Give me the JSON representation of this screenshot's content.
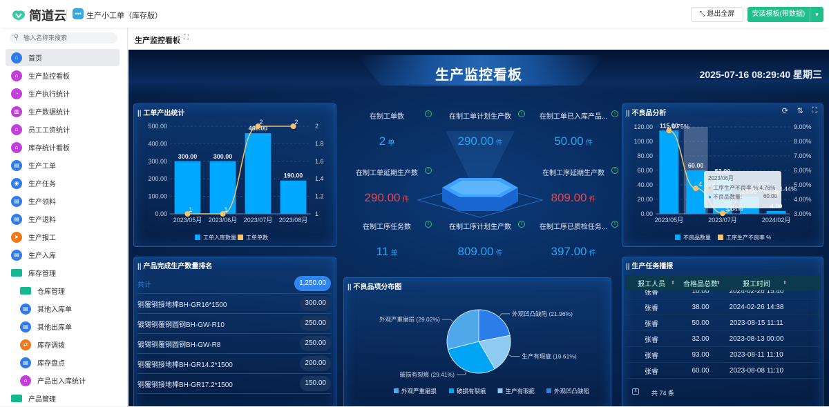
{
  "topbar": {
    "brand": "简道云",
    "app_icon": "chat-bubble-icon",
    "app_title": "生产小工单（库存版）",
    "exit_fullscreen": "退出全屏",
    "install_template": "安装模板(带数据)"
  },
  "sidebar": {
    "search_placeholder": "输入名称来搜索",
    "items": [
      {
        "label": "首页",
        "icon": "home-icon",
        "color": "#2f7bea",
        "active": true
      },
      {
        "label": "生产监控看板",
        "icon": "home-icon",
        "color": "#c040d8"
      },
      {
        "label": "生产执行统计",
        "icon": "pie-chart-icon",
        "color": "#c040d8"
      },
      {
        "label": "生产数据统计",
        "icon": "bar-chart-icon",
        "color": "#c040d8"
      },
      {
        "label": "员工工资统计",
        "icon": "dashboard-icon",
        "color": "#c040d8"
      },
      {
        "label": "库存统计看板",
        "icon": "dashboard-icon",
        "color": "#c040d8"
      },
      {
        "label": "生产工单",
        "icon": "form-icon",
        "color": "#2f7bea"
      },
      {
        "label": "生产任务",
        "icon": "circle-icon",
        "color": "#2f7bea"
      },
      {
        "label": "生产领料",
        "icon": "form-icon",
        "color": "#2f7bea"
      },
      {
        "label": "生产退料",
        "icon": "form-icon",
        "color": "#2f7bea"
      },
      {
        "label": "生产报工",
        "icon": "send-icon",
        "color": "#f07a18"
      },
      {
        "label": "生产入库",
        "icon": "form-icon",
        "color": "#2f7bea"
      },
      {
        "label": "库存管理",
        "icon": "folder-icon",
        "color": "#17b890",
        "folder": true
      },
      {
        "label": "仓库管理",
        "icon": "folder-icon",
        "color": "#17b890",
        "folder": true,
        "sub": true
      },
      {
        "label": "其他入库单",
        "icon": "form-icon",
        "color": "#2f7bea",
        "sub": true
      },
      {
        "label": "其他出库单",
        "icon": "form-icon",
        "color": "#2f7bea",
        "sub": true
      },
      {
        "label": "库存调拨",
        "icon": "transfer-icon",
        "color": "#f07a18",
        "sub": true
      },
      {
        "label": "库存盘点",
        "icon": "form-icon",
        "color": "#2f7bea",
        "sub": true
      },
      {
        "label": "产品出入库统计",
        "icon": "dashboard-icon",
        "color": "#c040d8",
        "sub": true
      },
      {
        "label": "产品管理",
        "icon": "folder-icon",
        "color": "#17b890",
        "folder": true
      }
    ]
  },
  "tab": {
    "title": "生产监控看板"
  },
  "dashboard": {
    "title": "生产监控看板",
    "datetime": "2025-07-16 08:29:40 星期三",
    "kpis": [
      {
        "label": "在制工单数",
        "value": "2",
        "unit": "单",
        "color": "blue"
      },
      {
        "label": "在制工单计划生产数",
        "value": "290.00",
        "unit": "件",
        "color": "blue"
      },
      {
        "label": "在制工单已入库产品...",
        "value": "50.00",
        "unit": "件",
        "color": "blue"
      },
      {
        "label": "在制工单延期生产数",
        "value": "290.00",
        "unit": "件",
        "color": "red"
      },
      {
        "label": "在制工序延期生产数",
        "value": "809.00",
        "unit": "件",
        "color": "red"
      },
      {
        "label": "在制工序任务数",
        "value": "11",
        "unit": "单",
        "color": "blue"
      },
      {
        "label": "在制工序计划生产数",
        "value": "809.00",
        "unit": "件",
        "color": "blue"
      },
      {
        "label": "在制工序已质检任务...",
        "value": "397.00",
        "unit": "件",
        "color": "blue"
      }
    ],
    "ranking": {
      "title": "产品完成生产数量排名",
      "rows": [
        {
          "name": "共计",
          "value": "1,250.00"
        },
        {
          "name": "铜覆钢接地棒BH-GR16*1500",
          "value": "300.00"
        },
        {
          "name": "镀锡铜覆钢圆钢BH-GW-R10",
          "value": "250.00"
        },
        {
          "name": "镀锡铜覆钢圆钢BH-GW-R8",
          "value": "250.00"
        },
        {
          "name": "铜覆钢接地棒BH-GR14.2*1500",
          "value": "200.00"
        },
        {
          "name": "铜覆钢接地棒BH-GR17.2*1500",
          "value": "150.00"
        }
      ]
    },
    "reports": {
      "title": "生产任务播报",
      "columns": [
        "报工人员",
        "合格品总数",
        "报工时间"
      ],
      "rows": [
        [
          "张睿",
          "10.00",
          "2024-02-26 15:40"
        ],
        [
          "张睿",
          "38.00",
          "2024-02-26 14:38"
        ],
        [
          "张睿",
          "50.00",
          "2023-08-15 11:11"
        ],
        [
          "张睿",
          "32.00",
          "2023-08-13 00:00"
        ],
        [
          "张睿",
          "93.00",
          "2023-08-11 11:10"
        ],
        [
          "张睿",
          "60.00",
          "2023-08-08 11:10"
        ]
      ],
      "total": "共 74 条"
    }
  },
  "chart_data": [
    {
      "type": "bar",
      "title": "工单产出统计",
      "categories": [
        "2023/05月",
        "2023/06月",
        "2023/07月",
        "2023/08月"
      ],
      "series": [
        {
          "name": "工单入库数量",
          "kind": "bar",
          "axis": "left",
          "values": [
            300,
            300,
            460,
            190
          ],
          "labels": [
            "300.00",
            "300.00",
            "460.00",
            "190.00"
          ],
          "color": "#00a8ff"
        },
        {
          "name": "工单单数",
          "kind": "line",
          "axis": "right",
          "values": [
            1,
            1,
            2,
            2
          ],
          "labels": [
            "1",
            "1",
            "2",
            "2"
          ],
          "color": "#f5c36b"
        }
      ],
      "ylim": [
        0,
        500
      ],
      "yticks": [
        "0.00",
        "100.00",
        "200.00",
        "300.00",
        "400.00",
        "500.00"
      ],
      "y2lim": [
        1,
        2
      ],
      "y2ticks": [
        "1",
        "1.2",
        "1.4",
        "1.6",
        "1.8",
        "2"
      ],
      "legend": "bottom"
    },
    {
      "type": "bar",
      "title": "不良品分析",
      "categories": [
        "2023/05月",
        "2023/06月",
        "2023/07月",
        "",
        "2024/02月"
      ],
      "series": [
        {
          "name": "不良品数量",
          "kind": "bar",
          "axis": "left",
          "values": [
            115,
            60,
            52,
            24,
            4
          ],
          "labels": [
            "115.00",
            "60.00",
            "52.00",
            "24.00",
            "4.00"
          ],
          "color": "#00a8ff"
        },
        {
          "name": "工序生产不良率 %",
          "kind": "line",
          "axis": "right",
          "values": [
            8.75,
            4.76,
            3.04,
            4.75,
            4.44
          ],
          "labels": [
            "8.75%",
            "4.76%",
            "3.04%",
            "4.75%",
            "4.44%"
          ],
          "color": "#f5c36b"
        }
      ],
      "ylim": [
        0,
        120
      ],
      "yticks": [
        "0.00",
        "20.00",
        "40.00",
        "60.00",
        "80.00",
        "100.00",
        "120.00"
      ],
      "y2lim": [
        3,
        9
      ],
      "y2ticks": [
        "3.00%",
        "4.00%",
        "5.00%",
        "6.00%",
        "7.00%",
        "8.00%",
        "9.00%"
      ],
      "legend": "bottom",
      "tooltip": {
        "category": "2023/06月",
        "lines": [
          {
            "label": "工序生产不良率 %:",
            "value": "4.76%",
            "color": "#f5c36b"
          },
          {
            "label": "不良品数量:",
            "value": "60.00",
            "color": "#00a8ff"
          }
        ]
      }
    },
    {
      "type": "pie",
      "title": "不良品项分布图",
      "legend": "bottom",
      "slices": [
        {
          "name": "外观凹凸缺陷",
          "pct": 21.96,
          "label": "外观凹凸缺陷 (21.96%)",
          "color": "#2b7de9"
        },
        {
          "name": "生产有瑕疵",
          "pct": 19.61,
          "label": "生产有瑕疵 (19.61%)",
          "color": "#8fcbf0"
        },
        {
          "name": "破损有裂痕",
          "pct": 29.41,
          "label": "破损有裂痕 (29.41%)",
          "color": "#00a4f5"
        },
        {
          "name": "外观严重磨损",
          "pct": 29.02,
          "label": "外观严重磨损 (29.02%)",
          "color": "#4fa8ea"
        }
      ],
      "legend_order": [
        3,
        2,
        1,
        0
      ]
    }
  ]
}
